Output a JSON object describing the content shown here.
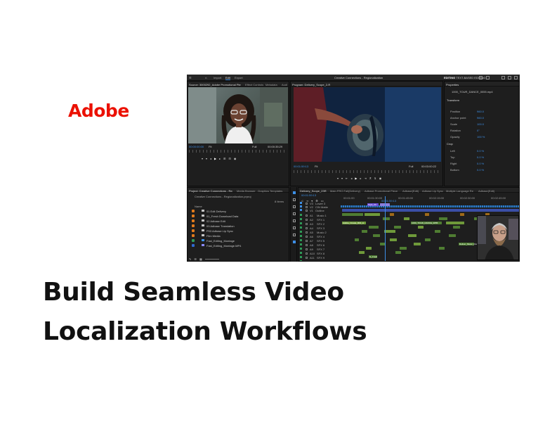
{
  "brand": {
    "logo_text": "Adobe",
    "logo_color": "#eb1000"
  },
  "headline": "Build Seamless Video Localization Workflows",
  "app": {
    "window_title": "Creative Connections - Regionalization",
    "workspace_tabs": [
      {
        "label": "Import",
        "active": false
      },
      {
        "label": "Edit",
        "active": true
      },
      {
        "label": "Export",
        "active": false
      }
    ],
    "mode_label": "EDITING",
    "mode_detail": "TEXT-BASED EDITING",
    "source_panel": {
      "tabs": [
        "Source: 3000292_Adobe Promotional Piece_v1_script",
        "Effect Controls",
        "Metadata",
        "Audi"
      ],
      "timecode_in": "00:00:00:00",
      "fit_label": "Fit",
      "resolution": "Full",
      "timecode_out": "00:00:35:29"
    },
    "program_panel": {
      "tabs": [
        "Program: Delivery_Scope_2-R"
      ],
      "timecode_in": "00:01:59:13",
      "fit_label": "Fit",
      "resolution": "Full",
      "timecode_out": "00:03:00:22"
    },
    "properties_panel": {
      "tab": "Properties",
      "clip_name": "1000_TOUR_DANCE_0055.mp4",
      "sections": [
        {
          "title": "Transform",
          "rows": [
            {
              "label": "Position",
              "value": "960.0"
            },
            {
              "label": "Anchor point",
              "value": "960.0"
            },
            {
              "label": "Scale",
              "value": "100.0"
            },
            {
              "label": "Rotation",
              "value": "0°"
            },
            {
              "label": "Opacity",
              "value": "100 %"
            }
          ]
        },
        {
          "title": "Crop",
          "rows": [
            {
              "label": "Left",
              "value": "0.0 %"
            },
            {
              "label": "Top",
              "value": "0.0 %"
            },
            {
              "label": "Right",
              "value": "0.0 %"
            },
            {
              "label": "Bottom",
              "value": "0.0 %"
            }
          ]
        }
      ],
      "input_speed_label": "Adjust speed..."
    },
    "project_panel": {
      "tabs": [
        "Project: Creative Connections - Regionalization",
        "Media Browser",
        "Graphics Templates"
      ],
      "path": "Creative Connections - Regionalization.prproj",
      "item_count": "8 Items",
      "column_header": "Name",
      "items": [
        {
          "name": "01 Edit Delivery",
          "type": "folder"
        },
        {
          "name": "01_Fresh Download Data",
          "type": "folder"
        },
        {
          "name": "02 Adbase Edit",
          "type": "folder"
        },
        {
          "name": "03 Adbase Translation",
          "type": "folder"
        },
        {
          "name": "P03 Adbase Lip Sync",
          "type": "folder"
        },
        {
          "name": "Film Media",
          "type": "folder"
        },
        {
          "name": "Fast_Editing_Montage",
          "type": "sequence"
        },
        {
          "name": "Fast_Editing_Montage.MP4",
          "type": "media"
        }
      ]
    },
    "timeline_panel": {
      "tabs": [
        "Delivery_Scope_23R",
        "Main PRO Fall(Delivery)",
        "Adbase Promotional Piece",
        "Adbase(Edit)",
        "Adbase Lip Sync",
        "Multiple Language Re",
        "Adbase(Edit)"
      ],
      "timecode": "00:01:59:13",
      "ruler_labels": [
        "00:01:00",
        "00:01:30:00",
        "00:01:45:00",
        "00:01:59:13",
        "00:02:15:00",
        "00:02:30:00",
        "00:02:45:00"
      ],
      "video_tracks": [
        "V3",
        "V2",
        "V1"
      ],
      "video_track_names": [
        "Lower 3",
        "CIN Matte",
        "Outline"
      ],
      "audio_tracks": [
        "A1",
        "A2",
        "A3",
        "A4",
        "A5",
        "A6",
        "A7",
        "A8",
        "A9",
        "A10",
        "A11",
        "A12",
        "A13"
      ],
      "audio_track_names": [
        "Music 1",
        "SFX 1",
        "SFX 2",
        "SFX 3",
        "Music 2",
        "SFX 4",
        "SFX 5",
        "SFX 6",
        "SFX 7",
        "SFX 8",
        "SFX 9",
        "SFX 10",
        "SFX 11"
      ],
      "clip_labels": [
        "Style_00",
        "1000_TOUR_DANCE_0055",
        "Adobe_Create_004_m",
        "Deliver_Music_Flow",
        "S_Creat"
      ]
    }
  }
}
